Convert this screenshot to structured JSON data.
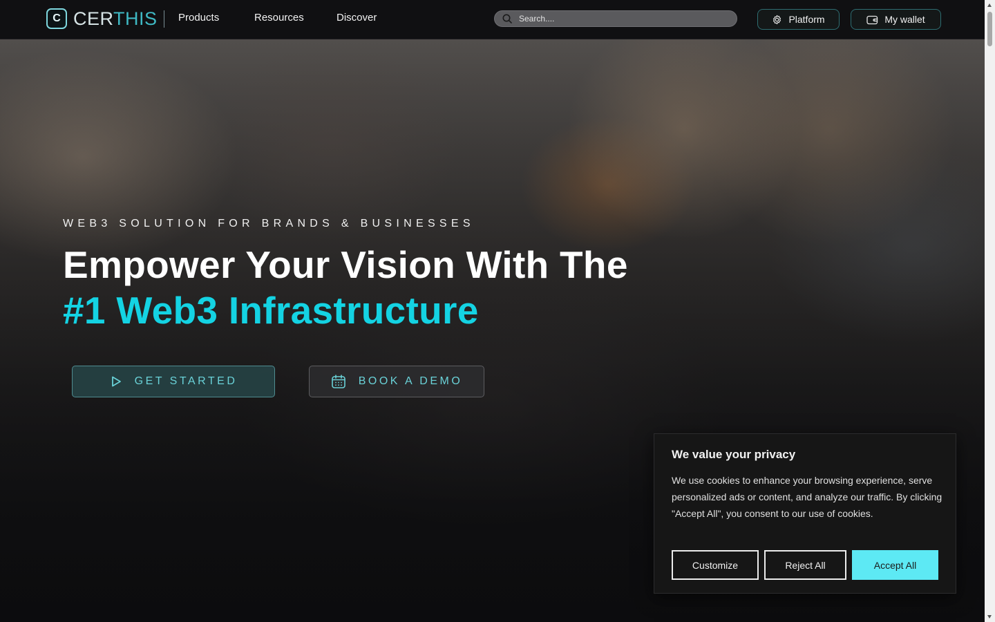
{
  "brand": {
    "mark": "C",
    "name_a": "CER",
    "name_b": "THIS"
  },
  "nav": {
    "links": [
      "Products",
      "Resources",
      "Discover"
    ],
    "search_placeholder": "Search....",
    "platform_label": "Platform",
    "wallet_label": "My wallet"
  },
  "hero": {
    "eyebrow": "WEB3 SOLUTION FOR BRANDS & BUSINESSES",
    "headline_line1": "Empower Your Vision With The",
    "headline_line2": "#1 Web3 Infrastructure",
    "cta_primary": "GET STARTED",
    "cta_secondary": "BOOK A DEMO"
  },
  "cookie": {
    "title": "We value your privacy",
    "text": "We use cookies to enhance your browsing experience, serve personalized ads or content, and analyze our traffic. By clicking \"Accept All\", you consent to our use of cookies.",
    "customize": "Customize",
    "reject": "Reject All",
    "accept": "Accept All"
  },
  "colors": {
    "accent": "#14d3e3",
    "accept_button": "#5de9f4",
    "cta_text": "#6ad2d8"
  },
  "icons": {
    "search": "search-icon",
    "platform": "gear-icon",
    "wallet": "wallet-icon",
    "cta_primary": "play-icon",
    "cta_secondary": "calendar-icon"
  }
}
